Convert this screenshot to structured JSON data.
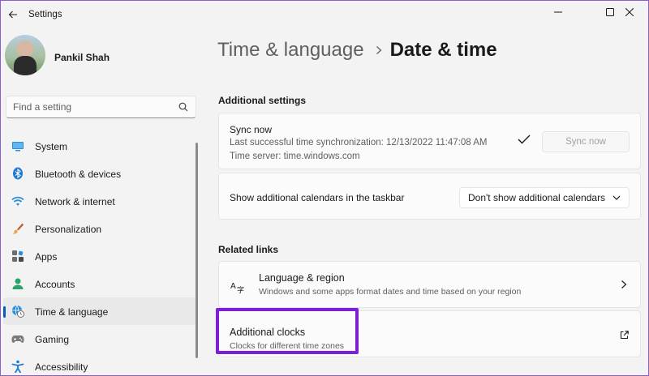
{
  "window": {
    "app_title": "Settings",
    "controls": {
      "minimize": "minimize-icon",
      "maximize": "maximize-icon",
      "close": "close-icon"
    }
  },
  "profile": {
    "name": "Pankil Shah"
  },
  "search": {
    "placeholder": "Find a setting"
  },
  "nav": {
    "items": [
      {
        "label": "System",
        "icon": "system-icon"
      },
      {
        "label": "Bluetooth & devices",
        "icon": "bluetooth-icon"
      },
      {
        "label": "Network & internet",
        "icon": "wifi-icon"
      },
      {
        "label": "Personalization",
        "icon": "brush-icon"
      },
      {
        "label": "Apps",
        "icon": "apps-icon"
      },
      {
        "label": "Accounts",
        "icon": "person-icon"
      },
      {
        "label": "Time & language",
        "icon": "clock-globe-icon",
        "active": true
      },
      {
        "label": "Gaming",
        "icon": "controller-icon"
      },
      {
        "label": "Accessibility",
        "icon": "accessibility-icon"
      }
    ]
  },
  "breadcrumb": {
    "parent": "Time & language",
    "current": "Date & time"
  },
  "additional_settings": {
    "heading": "Additional settings",
    "sync": {
      "title": "Sync now",
      "last_sync": "Last successful time synchronization: 12/13/2022 11:47:08 AM",
      "server": "Time server: time.windows.com",
      "button_label": "Sync now"
    },
    "calendars": {
      "label": "Show additional calendars in the taskbar",
      "selected": "Don't show additional calendars"
    }
  },
  "related_links": {
    "heading": "Related links",
    "language_region": {
      "title": "Language & region",
      "subtitle": "Windows and some apps format dates and time based on your region"
    },
    "additional_clocks": {
      "title": "Additional clocks",
      "subtitle": "Clocks for different time zones"
    }
  },
  "colors": {
    "accent": "#005fb8",
    "highlight_box": "#7c1fd9",
    "window_border": "#8a5cd6"
  }
}
